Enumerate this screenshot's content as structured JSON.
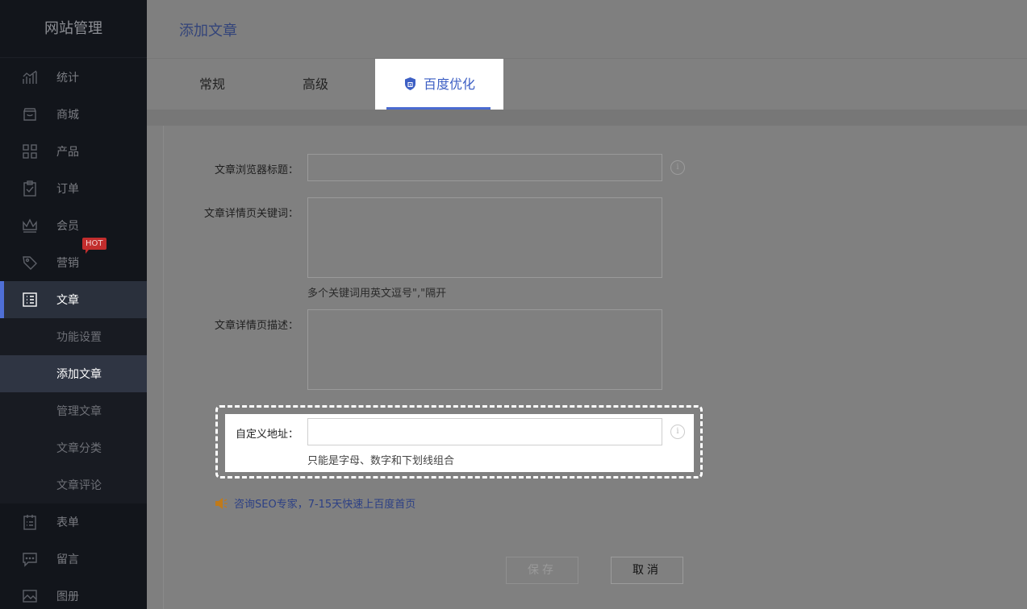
{
  "sidebar": {
    "title": "网站管理",
    "items": [
      {
        "label": "统计",
        "icon": "chart-icon"
      },
      {
        "label": "商城",
        "icon": "store-icon"
      },
      {
        "label": "产品",
        "icon": "grid-icon"
      },
      {
        "label": "订单",
        "icon": "clipboard-icon"
      },
      {
        "label": "会员",
        "icon": "crown-icon"
      },
      {
        "label": "营销",
        "icon": "tag-icon",
        "badge": "HOT"
      },
      {
        "label": "文章",
        "icon": "article-icon"
      },
      {
        "label": "表单",
        "icon": "form-icon"
      },
      {
        "label": "留言",
        "icon": "message-icon"
      },
      {
        "label": "图册",
        "icon": "image-icon"
      }
    ],
    "article_sub": [
      "功能设置",
      "添加文章",
      "管理文章",
      "文章分类",
      "文章评论"
    ]
  },
  "header": {
    "title": "添加文章"
  },
  "tabs": [
    "常规",
    "高级",
    "百度优化"
  ],
  "form": {
    "browser_title_label": "文章浏览器标题：",
    "keywords_label": "文章详情页关键词：",
    "keywords_hint": "多个关键词用英文逗号\",\"隔开",
    "description_label": "文章详情页描述：",
    "custom_url_label": "自定义地址：",
    "custom_url_hint": "只能是字母、数字和下划线组合",
    "browser_title_value": "",
    "keywords_value": "",
    "description_value": "",
    "custom_url_value": ""
  },
  "seo_promo": "咨询SEO专家，7-15天快速上百度首页",
  "buttons": {
    "save": "保存",
    "cancel": "取消"
  },
  "info_glyph": "i",
  "colors": {
    "accent": "#4a6ad0",
    "sidebar_bg": "#12151b",
    "hot_badge": "#c22d2d"
  }
}
